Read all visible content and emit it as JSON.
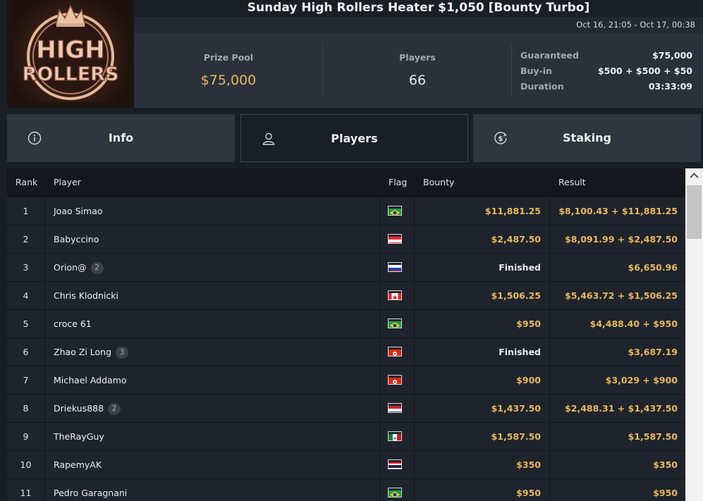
{
  "tournament": {
    "title": "Sunday High Rollers Heater $1,050 [Bounty Turbo]",
    "date_range": "Oct 16, 21:05 - Oct 17, 00:38",
    "logo_line1": "HIGH",
    "logo_line2": "ROLLERS"
  },
  "summary": {
    "prize_pool_label": "Prize Pool",
    "prize_pool_value": "$75,000",
    "players_label": "Players",
    "players_value": "66",
    "details": [
      {
        "key": "Guaranteed",
        "value": "$75,000"
      },
      {
        "key": "Buy-in",
        "value": "$500 + $500 + $50"
      },
      {
        "key": "Duration",
        "value": "03:33:09"
      }
    ]
  },
  "tabs": [
    {
      "label": "Info",
      "icon": "info-icon",
      "active": false
    },
    {
      "label": "Players",
      "icon": "user-icon",
      "active": true
    },
    {
      "label": "Staking",
      "icon": "dollar-coin-icon",
      "active": false
    }
  ],
  "table": {
    "headers": {
      "rank": "Rank",
      "player": "Player",
      "flag": "Flag",
      "bounty": "Bounty",
      "result": "Result"
    },
    "rows": [
      {
        "rank": "1",
        "player": "Joao Simao",
        "badge": "",
        "flag": "brazil",
        "bounty": "$11,881.25",
        "result": "$8,100.43 + $11,881.25"
      },
      {
        "rank": "2",
        "player": "Babyccino",
        "badge": "",
        "flag": "austria",
        "bounty": "$2,487.50",
        "result": "$8,091.99 + $2,487.50"
      },
      {
        "rank": "3",
        "player": "Orion@",
        "badge": "2",
        "flag": "russia",
        "bounty": "Finished",
        "result": "$6,650.96"
      },
      {
        "rank": "4",
        "player": "Chris Klodnicki",
        "badge": "",
        "flag": "canada",
        "bounty": "$1,506.25",
        "result": "$5,463.72 + $1,506.25"
      },
      {
        "rank": "5",
        "player": "croce 61",
        "badge": "",
        "flag": "brazil",
        "bounty": "$950",
        "result": "$4,488.40 + $950"
      },
      {
        "rank": "6",
        "player": "Zhao Zi Long",
        "badge": "3",
        "flag": "hongkong",
        "bounty": "Finished",
        "result": "$3,687.19"
      },
      {
        "rank": "7",
        "player": "Michael Addamo",
        "badge": "",
        "flag": "hongkong",
        "bounty": "$900",
        "result": "$3,029 + $900"
      },
      {
        "rank": "8",
        "player": "Driekus888",
        "badge": "2",
        "flag": "netherlands",
        "bounty": "$1,437.50",
        "result": "$2,488.31 + $1,437.50"
      },
      {
        "rank": "9",
        "player": "TheRayGuy",
        "badge": "",
        "flag": "mexico",
        "bounty": "$1,587.50",
        "result": "$1,587.50"
      },
      {
        "rank": "10",
        "player": "RapemyAK",
        "badge": "",
        "flag": "thailand",
        "bounty": "$350",
        "result": "$350"
      },
      {
        "rank": "11",
        "player": "Pedro Garagnani",
        "badge": "",
        "flag": "brazil",
        "bounty": "$950",
        "result": "$950"
      }
    ]
  },
  "colors": {
    "gold": "#e7b95b",
    "background": "#1a1e25",
    "panel": "#2a313b"
  }
}
